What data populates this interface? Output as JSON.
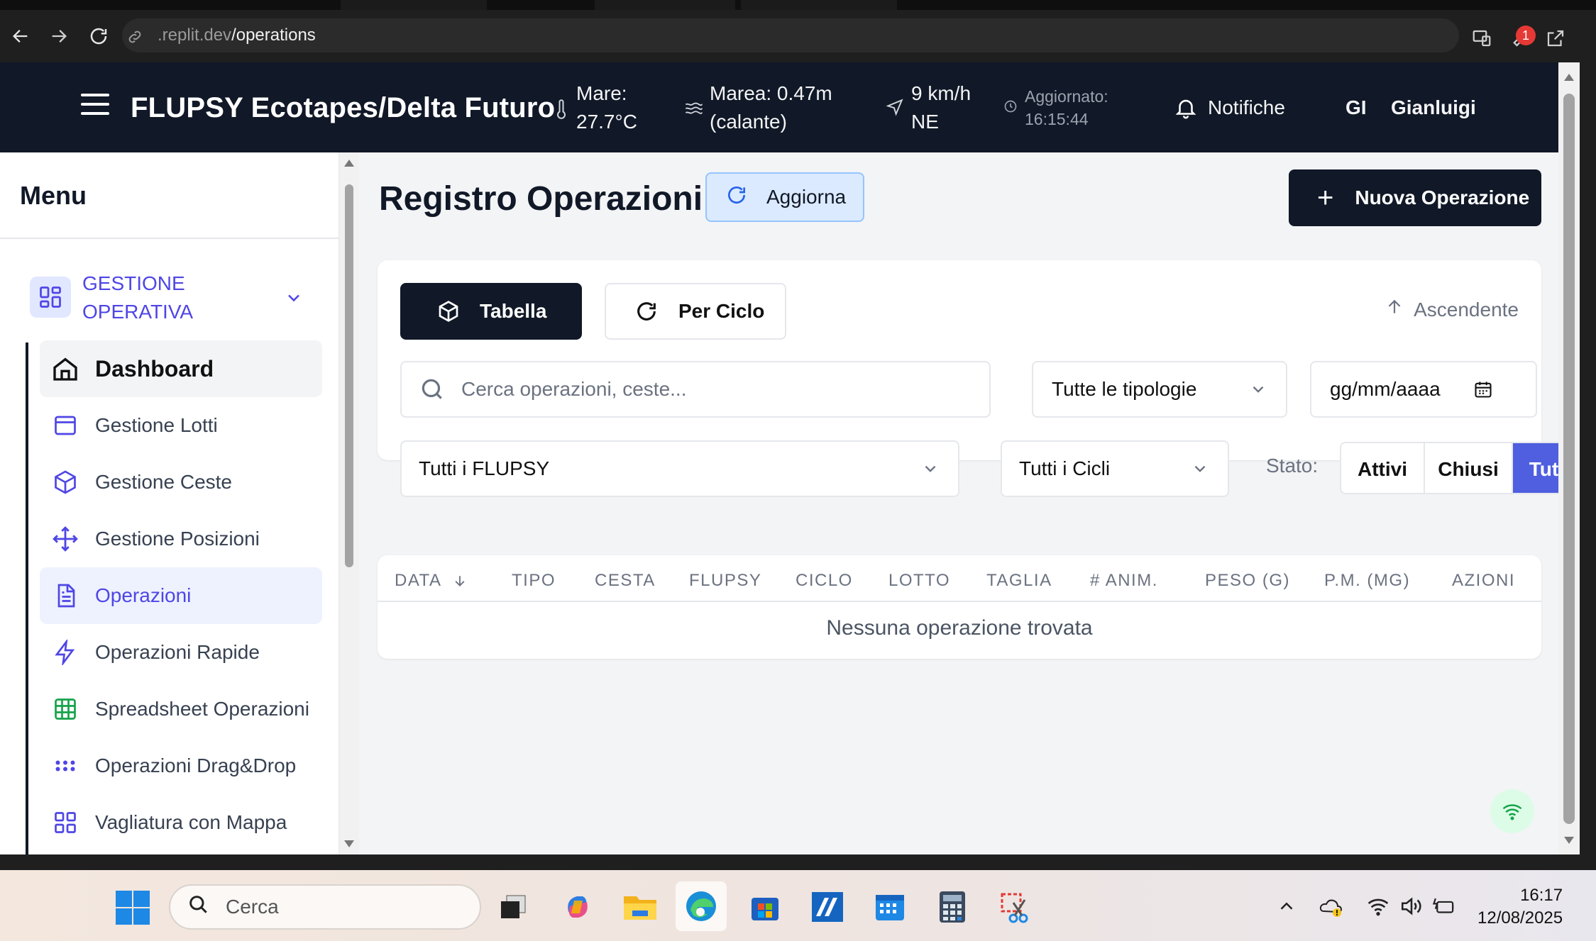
{
  "browser": {
    "url_host": ".replit.dev",
    "url_path": "/operations",
    "extension_badge": "1"
  },
  "header": {
    "app_title": "FLUPSY Ecotapes/Delta Futuro",
    "sea_label": "Mare:",
    "sea_value": "27.7°C",
    "tide_label": "Marea: 0.47m",
    "tide_value": "(calante)",
    "wind_speed": "9 km/h",
    "wind_dir": "NE",
    "updated_label": "Aggiornato:",
    "updated_time": "16:15:44",
    "notifications": "Notifiche",
    "user_initials": "GI",
    "user_name": "Gianluigi"
  },
  "sidebar": {
    "heading": "Menu",
    "section_title": "GESTIONE OPERATIVA",
    "items": [
      {
        "label": "Dashboard",
        "icon": "home-icon"
      },
      {
        "label": "Gestione Lotti",
        "icon": "package-icon"
      },
      {
        "label": "Gestione Ceste",
        "icon": "box-icon"
      },
      {
        "label": "Gestione Posizioni",
        "icon": "move-icon"
      },
      {
        "label": "Operazioni",
        "icon": "file-text-icon"
      },
      {
        "label": "Operazioni Rapide",
        "icon": "zap-icon"
      },
      {
        "label": "Spreadsheet Operazioni",
        "icon": "table-icon"
      },
      {
        "label": "Operazioni Drag&Drop",
        "icon": "grip-icon"
      },
      {
        "label": "Vagliatura con Mappa",
        "icon": "grid-icon"
      }
    ]
  },
  "main": {
    "title": "Registro Operazioni",
    "refresh_label": "Aggiorna",
    "new_operation_label": "Nuova Operazione",
    "view_table": "Tabella",
    "view_cycle": "Per Ciclo",
    "sort_order": "Ascendente",
    "search_placeholder": "Cerca operazioni, ceste...",
    "type_filter": "Tutte le tipologie",
    "date_placeholder": "gg/mm/aaaa",
    "flupsy_filter": "Tutti i FLUPSY",
    "cycle_filter": "Tutti i Cicli",
    "state_label": "Stato:",
    "state_options": [
      "Attivi",
      "Chiusi",
      "Tutti"
    ],
    "state_selected": "Tutti",
    "table_columns": [
      "DATA",
      "TIPO",
      "CESTA",
      "FLUPSY",
      "CICLO",
      "LOTTO",
      "TAGLIA",
      "# ANIM.",
      "PESO (G)",
      "P.M. (MG)",
      "AZIONI"
    ],
    "empty_message": "Nessuna operazione trovata"
  },
  "taskbar": {
    "search_label": "Cerca",
    "time": "16:17",
    "date": "12/08/2025"
  },
  "colors": {
    "header_bg": "#111827",
    "accent": "#4f46e5",
    "selected_segment": "#4f5fe0"
  }
}
